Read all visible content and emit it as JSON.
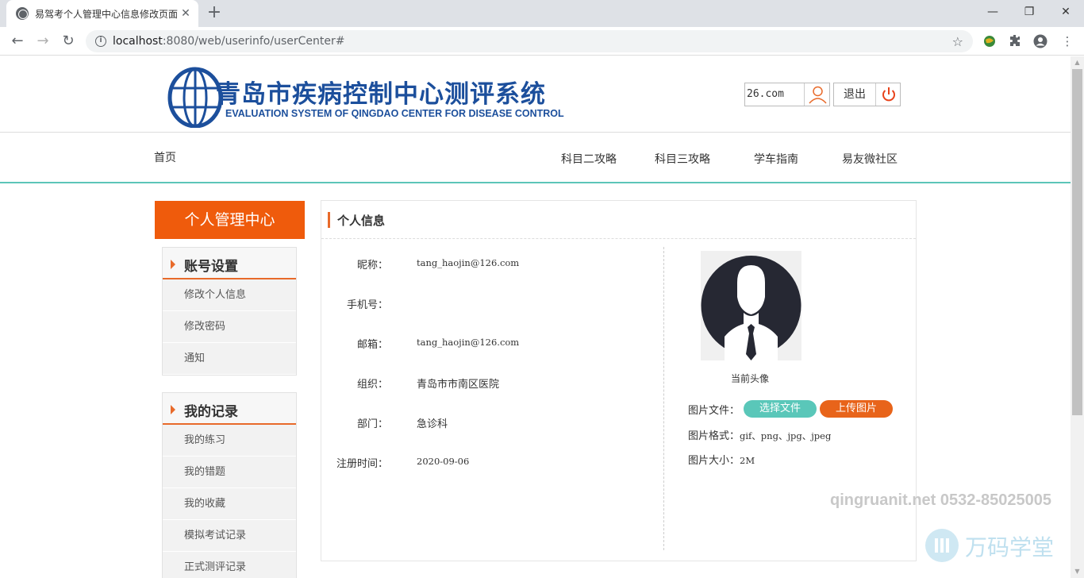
{
  "browser": {
    "tab_title": "易驾考个人管理中心信息修改页面",
    "tab_close": "✕",
    "new_tab": "+",
    "url_host": "localhost",
    "url_rest": ":8080/web/userinfo/userCenter#",
    "window_controls": [
      "—",
      "❐",
      "✕"
    ]
  },
  "header": {
    "logo_cn": "青岛市疾病控制中心测评系统",
    "logo_en": "EVALUATION SYSTEM OF QINGDAO CENTER FOR DISEASE CONTROL",
    "username": "26.com",
    "logout": "退出"
  },
  "nav": {
    "home": "首页",
    "items": [
      "科目二攻略",
      "科目三攻略",
      "学车指南",
      "易友微社区"
    ]
  },
  "sidebar": {
    "title": "个人管理中心",
    "groups": [
      {
        "title": "账号设置",
        "items": [
          "修改个人信息",
          "修改密码",
          "通知"
        ]
      },
      {
        "title": "我的记录",
        "items": [
          "我的练习",
          "我的错题",
          "我的收藏",
          "模拟考试记录",
          "正式测评记录"
        ]
      }
    ]
  },
  "panel": {
    "title": "个人信息",
    "fields": [
      {
        "label": "昵称：",
        "value": "tang_haojin@126.com"
      },
      {
        "label": "手机号：",
        "value": ""
      },
      {
        "label": "邮箱：",
        "value": "tang_haojin@126.com"
      },
      {
        "label": "组织：",
        "value": "青岛市市南区医院"
      },
      {
        "label": "部门：",
        "value": "急诊科"
      },
      {
        "label": "注册时间：",
        "value": "2020-09-06"
      }
    ],
    "avatar_caption": "当前头像",
    "file_label": "图片文件：",
    "choose_file": "选择文件",
    "upload": "上传图片",
    "format_label": "图片格式：",
    "format_value": "gif、png、jpg、jpeg",
    "size_label": "图片大小：",
    "size_value": "2M"
  },
  "watermark": {
    "contact": "qingruanit.net 0532-85025005",
    "brand": "万码学堂"
  },
  "colors": {
    "accent_orange": "#ef5b0c",
    "nav_line": "#5cc5b8",
    "logo_blue": "#1c4f9c",
    "choose_btn": "#5ac7b9",
    "upload_btn": "#e8641a"
  }
}
